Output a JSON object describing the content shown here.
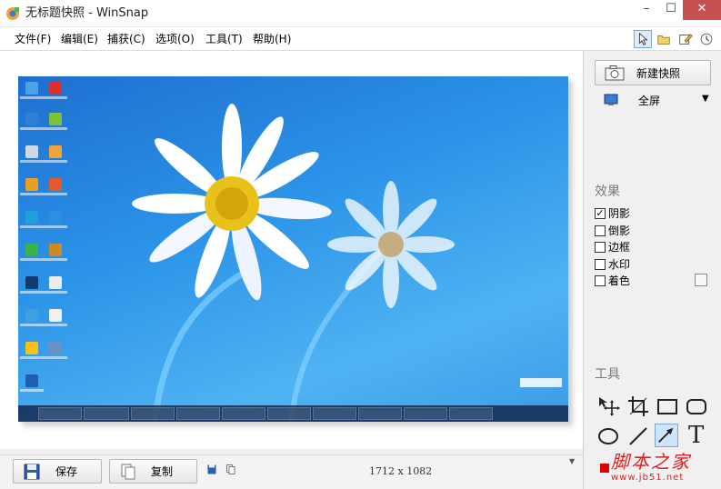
{
  "window": {
    "title": "无标题快照 - WinSnap",
    "minimize": "–",
    "maximize": "☐",
    "close": "✕"
  },
  "menu": {
    "items": [
      "文件(F)",
      "编辑(E)",
      "捕获(C)",
      "选项(O)",
      "工具(T)",
      "帮助(H)"
    ]
  },
  "panel": {
    "new_snapshot": "新建快照",
    "capture_mode": "全屏",
    "effects_title": "效果",
    "effects": [
      {
        "label": "阴影",
        "checked": true
      },
      {
        "label": "倒影",
        "checked": false
      },
      {
        "label": "边框",
        "checked": false
      },
      {
        "label": "水印",
        "checked": false
      },
      {
        "label": "着色",
        "checked": false
      }
    ],
    "tools_title": "工具",
    "tools": [
      "move-tool",
      "crop-tool",
      "rectangle-tool",
      "rounded-rectangle-tool",
      "ellipse-tool",
      "line-tool",
      "arrow-tool",
      "text-tool"
    ],
    "text_tool_glyph": "T"
  },
  "bottom": {
    "save": "保存",
    "copy": "复制",
    "dimensions": "1712 x 1082"
  },
  "watermark": {
    "text": "脚本之家",
    "url": "www.jb51.net"
  },
  "colors": {
    "close": "#c75050",
    "accent": "#7aa7d9",
    "desktop_blue": "#2b93e8",
    "watermark_red": "#e02020"
  }
}
